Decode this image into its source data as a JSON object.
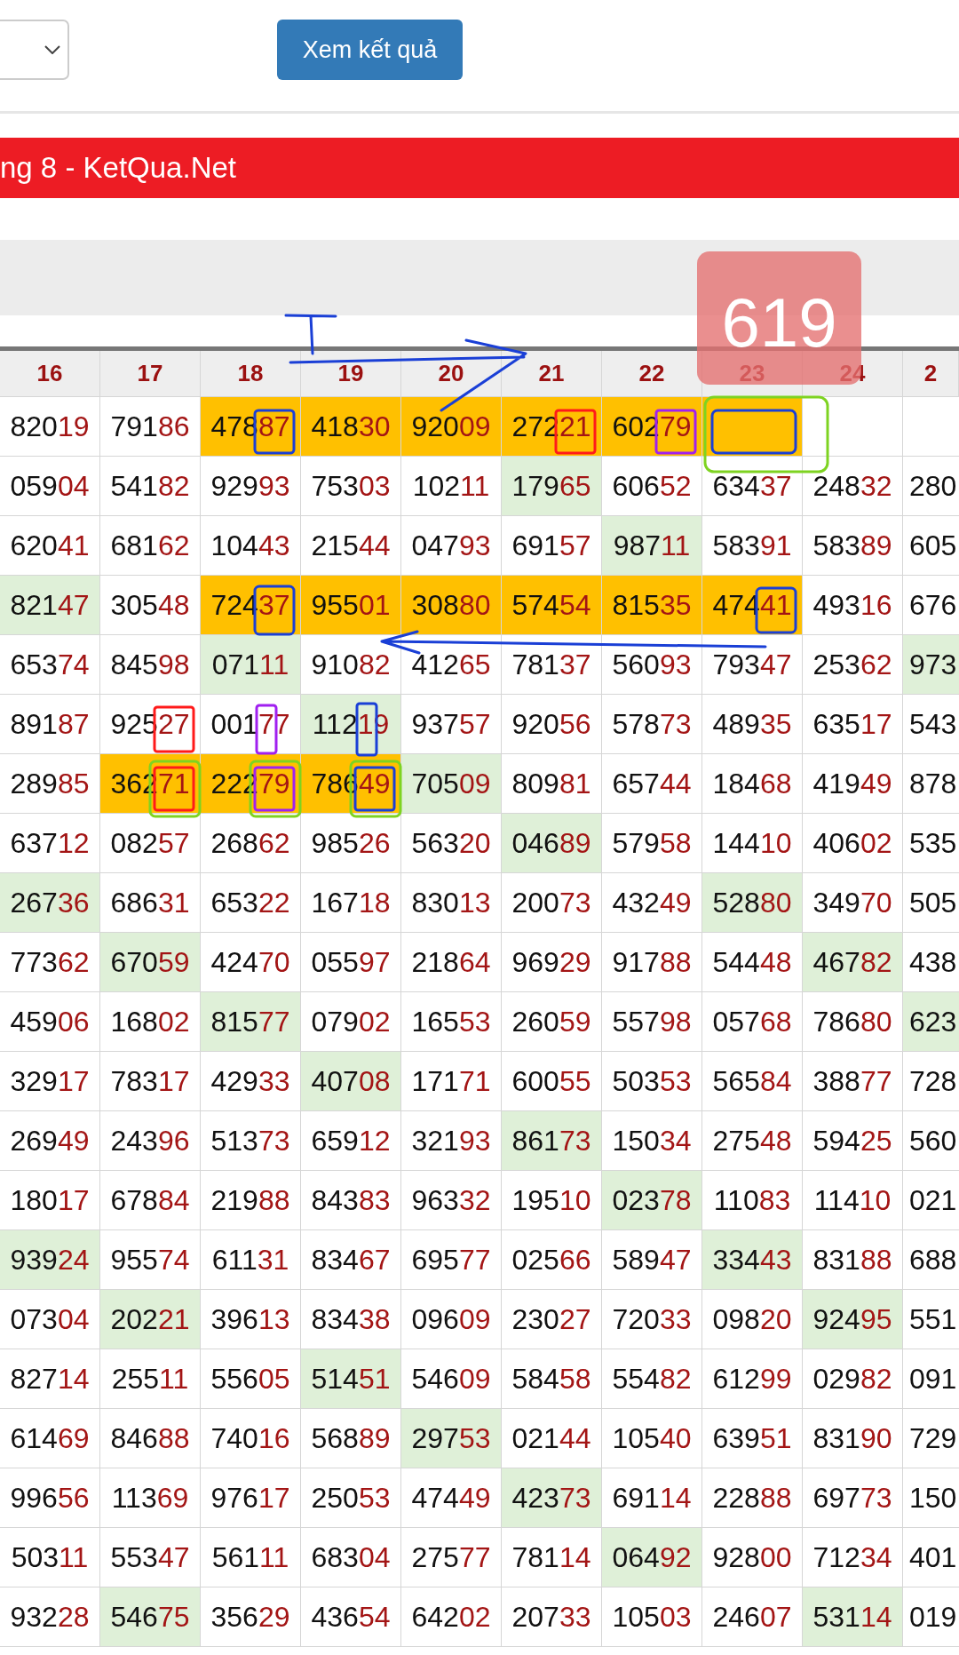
{
  "toolbar": {
    "button": {
      "label": "Xem kết quả"
    }
  },
  "banner": {
    "title": "ng 8 - KetQua.Net"
  },
  "badge": {
    "text": "619"
  },
  "table": {
    "columns": [
      "16",
      "17",
      "18",
      "19",
      "20",
      "21",
      "22",
      "23",
      "24",
      "2"
    ],
    "rows": [
      {
        "cells": [
          {
            "lead": "820",
            "tail": "19"
          },
          {
            "lead": "791",
            "tail": "86"
          },
          {
            "lead": "478",
            "tail": "87",
            "color": "#ffc000"
          },
          {
            "lead": "418",
            "tail": "30",
            "color": "#ffc000"
          },
          {
            "lead": "920",
            "tail": "09",
            "color": "#ffc000"
          },
          {
            "lead": "272",
            "tail": "21",
            "color": "#ffc000"
          },
          {
            "lead": "602",
            "tail": "79",
            "color": "#ffc000"
          },
          {
            "color": "#ffc000"
          },
          {},
          {}
        ]
      },
      {
        "cells": [
          {
            "lead": "059",
            "tail": "04"
          },
          {
            "lead": "541",
            "tail": "82"
          },
          {
            "lead": "929",
            "tail": "93"
          },
          {
            "lead": "753",
            "tail": "03"
          },
          {
            "lead": "102",
            "tail": "11"
          },
          {
            "lead": "179",
            "tail": "65",
            "color": "#dff0d8"
          },
          {
            "lead": "606",
            "tail": "52"
          },
          {
            "lead": "634",
            "tail": "37"
          },
          {
            "lead": "248",
            "tail": "32"
          },
          {
            "lead": "280"
          }
        ]
      },
      {
        "cells": [
          {
            "lead": "620",
            "tail": "41"
          },
          {
            "lead": "681",
            "tail": "62"
          },
          {
            "lead": "104",
            "tail": "43"
          },
          {
            "lead": "215",
            "tail": "44"
          },
          {
            "lead": "047",
            "tail": "93"
          },
          {
            "lead": "691",
            "tail": "57"
          },
          {
            "lead": "987",
            "tail": "11",
            "color": "#dff0d8"
          },
          {
            "lead": "583",
            "tail": "91"
          },
          {
            "lead": "583",
            "tail": "89"
          },
          {
            "lead": "605"
          }
        ]
      },
      {
        "cells": [
          {
            "lead": "821",
            "tail": "47",
            "color": "#dff0d8"
          },
          {
            "lead": "305",
            "tail": "48"
          },
          {
            "lead": "724",
            "tail": "37",
            "color": "#ffc000"
          },
          {
            "lead": "955",
            "tail": "01",
            "color": "#ffc000"
          },
          {
            "lead": "308",
            "tail": "80",
            "color": "#ffc000"
          },
          {
            "lead": "574",
            "tail": "54",
            "color": "#ffc000"
          },
          {
            "lead": "815",
            "tail": "35",
            "color": "#ffc000"
          },
          {
            "lead": "474",
            "tail": "41",
            "color": "#ffc000"
          },
          {
            "lead": "493",
            "tail": "16"
          },
          {
            "lead": "676"
          }
        ]
      },
      {
        "cells": [
          {
            "lead": "653",
            "tail": "74"
          },
          {
            "lead": "845",
            "tail": "98"
          },
          {
            "lead": "071",
            "tail": "11",
            "color": "#dff0d8"
          },
          {
            "lead": "910",
            "tail": "82"
          },
          {
            "lead": "412",
            "tail": "65"
          },
          {
            "lead": "781",
            "tail": "37"
          },
          {
            "lead": "560",
            "tail": "93"
          },
          {
            "lead": "793",
            "tail": "47"
          },
          {
            "lead": "253",
            "tail": "62"
          },
          {
            "lead": "973",
            "color": "#dff0d8"
          }
        ]
      },
      {
        "cells": [
          {
            "lead": "891",
            "tail": "87"
          },
          {
            "lead": "925",
            "tail": "27"
          },
          {
            "lead": "001",
            "tail": "77"
          },
          {
            "lead": "112",
            "tail": "19",
            "color": "#dff0d8"
          },
          {
            "lead": "937",
            "tail": "57"
          },
          {
            "lead": "920",
            "tail": "56"
          },
          {
            "lead": "578",
            "tail": "73"
          },
          {
            "lead": "489",
            "tail": "35"
          },
          {
            "lead": "635",
            "tail": "17"
          },
          {
            "lead": "543"
          }
        ]
      },
      {
        "cells": [
          {
            "lead": "289",
            "tail": "85"
          },
          {
            "lead": "362",
            "tail": "71",
            "color": "#ffc000"
          },
          {
            "lead": "222",
            "tail": "79",
            "color": "#ffc000"
          },
          {
            "lead": "786",
            "tail": "49",
            "color": "#ffc000"
          },
          {
            "lead": "705",
            "tail": "09",
            "color": "#dff0d8"
          },
          {
            "lead": "809",
            "tail": "81"
          },
          {
            "lead": "657",
            "tail": "44"
          },
          {
            "lead": "184",
            "tail": "68"
          },
          {
            "lead": "419",
            "tail": "49"
          },
          {
            "lead": "878"
          }
        ]
      },
      {
        "cells": [
          {
            "lead": "637",
            "tail": "12"
          },
          {
            "lead": "082",
            "tail": "57"
          },
          {
            "lead": "268",
            "tail": "62"
          },
          {
            "lead": "985",
            "tail": "26"
          },
          {
            "lead": "563",
            "tail": "20"
          },
          {
            "lead": "046",
            "tail": "89",
            "color": "#dff0d8"
          },
          {
            "lead": "579",
            "tail": "58"
          },
          {
            "lead": "144",
            "tail": "10"
          },
          {
            "lead": "406",
            "tail": "02"
          },
          {
            "lead": "535"
          }
        ]
      },
      {
        "cells": [
          {
            "lead": "267",
            "tail": "36",
            "color": "#dff0d8"
          },
          {
            "lead": "686",
            "tail": "31"
          },
          {
            "lead": "653",
            "tail": "22"
          },
          {
            "lead": "167",
            "tail": "18"
          },
          {
            "lead": "830",
            "tail": "13"
          },
          {
            "lead": "200",
            "tail": "73"
          },
          {
            "lead": "432",
            "tail": "49"
          },
          {
            "lead": "528",
            "tail": "80",
            "color": "#dff0d8"
          },
          {
            "lead": "349",
            "tail": "70"
          },
          {
            "lead": "505"
          }
        ]
      },
      {
        "cells": [
          {
            "lead": "773",
            "tail": "62"
          },
          {
            "lead": "670",
            "tail": "59",
            "color": "#dff0d8"
          },
          {
            "lead": "424",
            "tail": "70"
          },
          {
            "lead": "055",
            "tail": "97"
          },
          {
            "lead": "218",
            "tail": "64"
          },
          {
            "lead": "969",
            "tail": "29"
          },
          {
            "lead": "917",
            "tail": "88"
          },
          {
            "lead": "544",
            "tail": "48"
          },
          {
            "lead": "467",
            "tail": "82",
            "color": "#dff0d8"
          },
          {
            "lead": "438"
          }
        ]
      },
      {
        "cells": [
          {
            "lead": "459",
            "tail": "06"
          },
          {
            "lead": "168",
            "tail": "02"
          },
          {
            "lead": "815",
            "tail": "77",
            "color": "#dff0d8"
          },
          {
            "lead": "079",
            "tail": "02"
          },
          {
            "lead": "165",
            "tail": "53"
          },
          {
            "lead": "260",
            "tail": "59"
          },
          {
            "lead": "557",
            "tail": "98"
          },
          {
            "lead": "057",
            "tail": "68"
          },
          {
            "lead": "786",
            "tail": "80"
          },
          {
            "lead": "623",
            "color": "#dff0d8"
          }
        ]
      },
      {
        "cells": [
          {
            "lead": "329",
            "tail": "17"
          },
          {
            "lead": "783",
            "tail": "17"
          },
          {
            "lead": "429",
            "tail": "33"
          },
          {
            "lead": "407",
            "tail": "08",
            "color": "#dff0d8"
          },
          {
            "lead": "171",
            "tail": "71"
          },
          {
            "lead": "600",
            "tail": "55"
          },
          {
            "lead": "503",
            "tail": "53"
          },
          {
            "lead": "565",
            "tail": "84"
          },
          {
            "lead": "388",
            "tail": "77"
          },
          {
            "lead": "728"
          }
        ]
      },
      {
        "cells": [
          {
            "lead": "269",
            "tail": "49"
          },
          {
            "lead": "243",
            "tail": "96"
          },
          {
            "lead": "513",
            "tail": "73"
          },
          {
            "lead": "659",
            "tail": "12"
          },
          {
            "lead": "321",
            "tail": "93"
          },
          {
            "lead": "861",
            "tail": "73",
            "color": "#dff0d8"
          },
          {
            "lead": "150",
            "tail": "34"
          },
          {
            "lead": "275",
            "tail": "48"
          },
          {
            "lead": "594",
            "tail": "25"
          },
          {
            "lead": "560"
          }
        ]
      },
      {
        "cells": [
          {
            "lead": "180",
            "tail": "17"
          },
          {
            "lead": "678",
            "tail": "84"
          },
          {
            "lead": "219",
            "tail": "88"
          },
          {
            "lead": "843",
            "tail": "83"
          },
          {
            "lead": "963",
            "tail": "32"
          },
          {
            "lead": "195",
            "tail": "10"
          },
          {
            "lead": "023",
            "tail": "78",
            "color": "#dff0d8"
          },
          {
            "lead": "110",
            "tail": "83"
          },
          {
            "lead": "114",
            "tail": "10"
          },
          {
            "lead": "021"
          }
        ]
      },
      {
        "cells": [
          {
            "lead": "939",
            "tail": "24",
            "color": "#dff0d8"
          },
          {
            "lead": "955",
            "tail": "74"
          },
          {
            "lead": "611",
            "tail": "31"
          },
          {
            "lead": "834",
            "tail": "67"
          },
          {
            "lead": "695",
            "tail": "77"
          },
          {
            "lead": "025",
            "tail": "66"
          },
          {
            "lead": "589",
            "tail": "47"
          },
          {
            "lead": "334",
            "tail": "43",
            "color": "#dff0d8"
          },
          {
            "lead": "831",
            "tail": "88"
          },
          {
            "lead": "688"
          }
        ]
      },
      {
        "cells": [
          {
            "lead": "073",
            "tail": "04"
          },
          {
            "lead": "202",
            "tail": "21",
            "color": "#dff0d8"
          },
          {
            "lead": "396",
            "tail": "13"
          },
          {
            "lead": "834",
            "tail": "38"
          },
          {
            "lead": "096",
            "tail": "09"
          },
          {
            "lead": "230",
            "tail": "27"
          },
          {
            "lead": "720",
            "tail": "33"
          },
          {
            "lead": "098",
            "tail": "20"
          },
          {
            "lead": "924",
            "tail": "95",
            "color": "#dff0d8"
          },
          {
            "lead": "551"
          }
        ]
      },
      {
        "cells": [
          {
            "lead": "827",
            "tail": "14"
          },
          {
            "lead": "255",
            "tail": "11"
          },
          {
            "lead": "556",
            "tail": "05"
          },
          {
            "lead": "514",
            "tail": "51",
            "color": "#dff0d8"
          },
          {
            "lead": "546",
            "tail": "09"
          },
          {
            "lead": "584",
            "tail": "58"
          },
          {
            "lead": "554",
            "tail": "82"
          },
          {
            "lead": "612",
            "tail": "99"
          },
          {
            "lead": "029",
            "tail": "82"
          },
          {
            "lead": "091"
          }
        ]
      },
      {
        "cells": [
          {
            "lead": "614",
            "tail": "69"
          },
          {
            "lead": "846",
            "tail": "88"
          },
          {
            "lead": "740",
            "tail": "16"
          },
          {
            "lead": "568",
            "tail": "89"
          },
          {
            "lead": "297",
            "tail": "53",
            "color": "#dff0d8"
          },
          {
            "lead": "021",
            "tail": "44"
          },
          {
            "lead": "105",
            "tail": "40"
          },
          {
            "lead": "639",
            "tail": "51"
          },
          {
            "lead": "831",
            "tail": "90"
          },
          {
            "lead": "729"
          }
        ]
      },
      {
        "cells": [
          {
            "lead": "996",
            "tail": "56"
          },
          {
            "lead": "113",
            "tail": "69"
          },
          {
            "lead": "976",
            "tail": "17"
          },
          {
            "lead": "250",
            "tail": "53"
          },
          {
            "lead": "474",
            "tail": "49"
          },
          {
            "lead": "423",
            "tail": "73",
            "color": "#dff0d8"
          },
          {
            "lead": "691",
            "tail": "14"
          },
          {
            "lead": "228",
            "tail": "88"
          },
          {
            "lead": "697",
            "tail": "73"
          },
          {
            "lead": "150"
          }
        ]
      },
      {
        "cells": [
          {
            "lead": "503",
            "tail": "11"
          },
          {
            "lead": "553",
            "tail": "47"
          },
          {
            "lead": "561",
            "tail": "11"
          },
          {
            "lead": "683",
            "tail": "04"
          },
          {
            "lead": "275",
            "tail": "77"
          },
          {
            "lead": "781",
            "tail": "14"
          },
          {
            "lead": "064",
            "tail": "92",
            "color": "#dff0d8"
          },
          {
            "lead": "928",
            "tail": "00"
          },
          {
            "lead": "712",
            "tail": "34"
          },
          {
            "lead": "401"
          }
        ]
      },
      {
        "cells": [
          {
            "lead": "932",
            "tail": "28"
          },
          {
            "lead": "546",
            "tail": "75",
            "color": "#dff0d8"
          },
          {
            "lead": "356",
            "tail": "29"
          },
          {
            "lead": "436",
            "tail": "54"
          },
          {
            "lead": "642",
            "tail": "02"
          },
          {
            "lead": "207",
            "tail": "33"
          },
          {
            "lead": "105",
            "tail": "03"
          },
          {
            "lead": "246",
            "tail": "07"
          },
          {
            "lead": "531",
            "tail": "14",
            "color": "#dff0d8"
          },
          {
            "lead": "019"
          }
        ]
      }
    ]
  }
}
